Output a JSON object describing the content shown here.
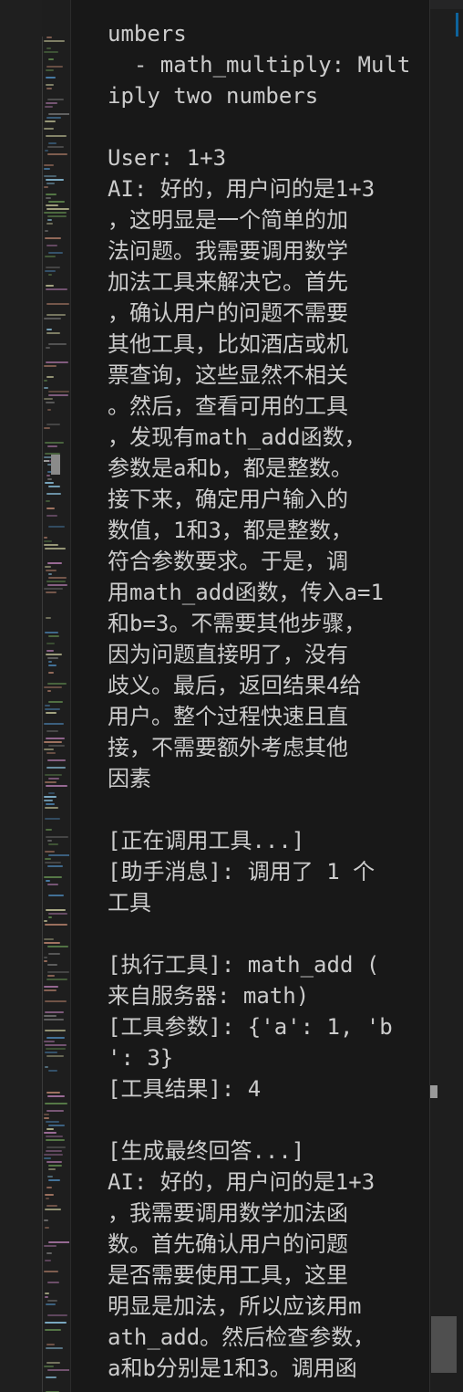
{
  "terminal": {
    "lines": [
      "umbers",
      "  - math_multiply: Mult",
      "iply two numbers",
      "",
      "User: 1+3",
      "AI: 好的，用户问的是1+3",
      "，这明显是一个简单的加",
      "法问题。我需要调用数学",
      "加法工具来解决它。首先",
      "，确认用户的问题不需要",
      "其他工具，比如酒店或机",
      "票查询，这些显然不相关",
      "。然后，查看可用的工具",
      "，发现有math_add函数，",
      "参数是a和b，都是整数。",
      "接下来，确定用户输入的",
      "数值，1和3，都是整数，",
      "符合参数要求。于是，调",
      "用math_add函数，传入a=1",
      "和b=3。不需要其他步骤，",
      "因为问题直接明了，没有",
      "歧义。最后，返回结果4给",
      "用户。整个过程快速且直",
      "接，不需要额外考虑其他",
      "因素",
      "",
      "[正在调用工具...]",
      "[助手消息]: 调用了 1 个",
      "工具",
      "",
      "[执行工具]: math_add (",
      "来自服务器: math)",
      "[工具参数]: {'a': 1, 'b",
      "': 3}",
      "[工具结果]: 4",
      "",
      "[生成最终回答...]",
      "AI: 好的，用户问的是1+3",
      "，我需要调用数学加法函",
      "数。首先确认用户的问题",
      "是否需要使用工具，这里",
      "明显是加法，所以应该用m",
      "ath_add。然后检查参数，",
      "a和b分别是1和3。调用函"
    ]
  },
  "colors": {
    "terminal_background": "#181818",
    "terminal_text": "#cccccc",
    "editor_background": "#1e1e1e",
    "scrollbar_thumb": "#4f4f4f",
    "accent": "#0e639c"
  }
}
